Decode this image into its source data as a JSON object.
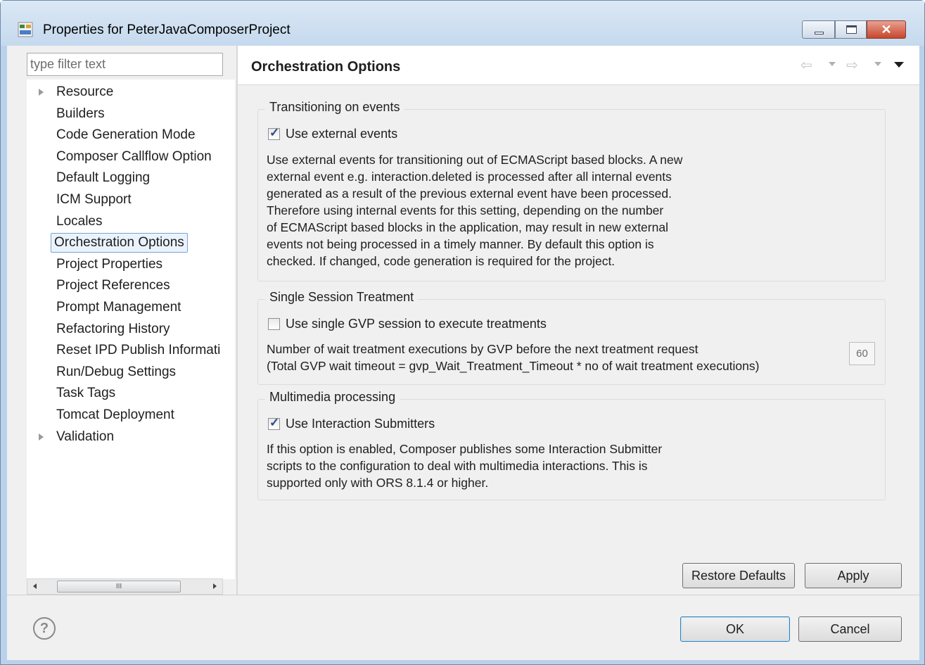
{
  "window": {
    "title": "Properties for PeterJavaComposerProject"
  },
  "filter": {
    "placeholder": "type filter text"
  },
  "tree": {
    "items": [
      {
        "label": "Resource",
        "expandable": true
      },
      {
        "label": "Builders"
      },
      {
        "label": "Code Generation Mode"
      },
      {
        "label": "Composer Callflow Option"
      },
      {
        "label": "Default Logging"
      },
      {
        "label": "ICM Support"
      },
      {
        "label": "Locales"
      },
      {
        "label": "Orchestration Options",
        "selected": true
      },
      {
        "label": "Project Properties"
      },
      {
        "label": "Project References"
      },
      {
        "label": "Prompt Management"
      },
      {
        "label": "Refactoring History"
      },
      {
        "label": "Reset IPD Publish Informati"
      },
      {
        "label": "Run/Debug Settings"
      },
      {
        "label": "Task Tags"
      },
      {
        "label": "Tomcat Deployment"
      },
      {
        "label": "Validation",
        "expandable": true
      }
    ],
    "scroll_thumb_label": "III"
  },
  "page": {
    "title": "Orchestration Options",
    "nav_back": "⇦",
    "nav_forward": "⇨"
  },
  "groups": {
    "transitioning": {
      "title": "Transitioning on events",
      "checkbox_label": "Use external events",
      "checked": true,
      "description": "Use external events for transitioning out of ECMAScript based blocks. A new\nexternal event e.g. interaction.deleted is processed after all internal events\ngenerated as a result of the previous external event have been processed.\nTherefore using internal events for this setting, depending on the number\nof ECMAScript based blocks in the application, may result in new external\nevents not being processed in a timely manner. By default this option is\nchecked. If changed, code generation is required for the project."
    },
    "single_session": {
      "title": "Single Session Treatment",
      "checkbox_label": "Use single GVP session to execute treatments",
      "checked": false,
      "description": "Number of wait treatment executions by GVP before the next treatment request\n(Total GVP wait timeout = gvp_Wait_Treatment_Timeout * no of wait treatment executions)",
      "wait_count": "60"
    },
    "multimedia": {
      "title": "Multimedia processing",
      "checkbox_label": "Use Interaction Submitters",
      "checked": true,
      "description": "If this option is enabled, Composer publishes some Interaction Submitter\nscripts to the configuration to deal with multimedia interactions. This is\nsupported only with ORS 8.1.4 or higher."
    }
  },
  "buttons": {
    "restore_defaults": "Restore Defaults",
    "apply": "Apply",
    "ok": "OK",
    "cancel": "Cancel",
    "help": "?"
  }
}
